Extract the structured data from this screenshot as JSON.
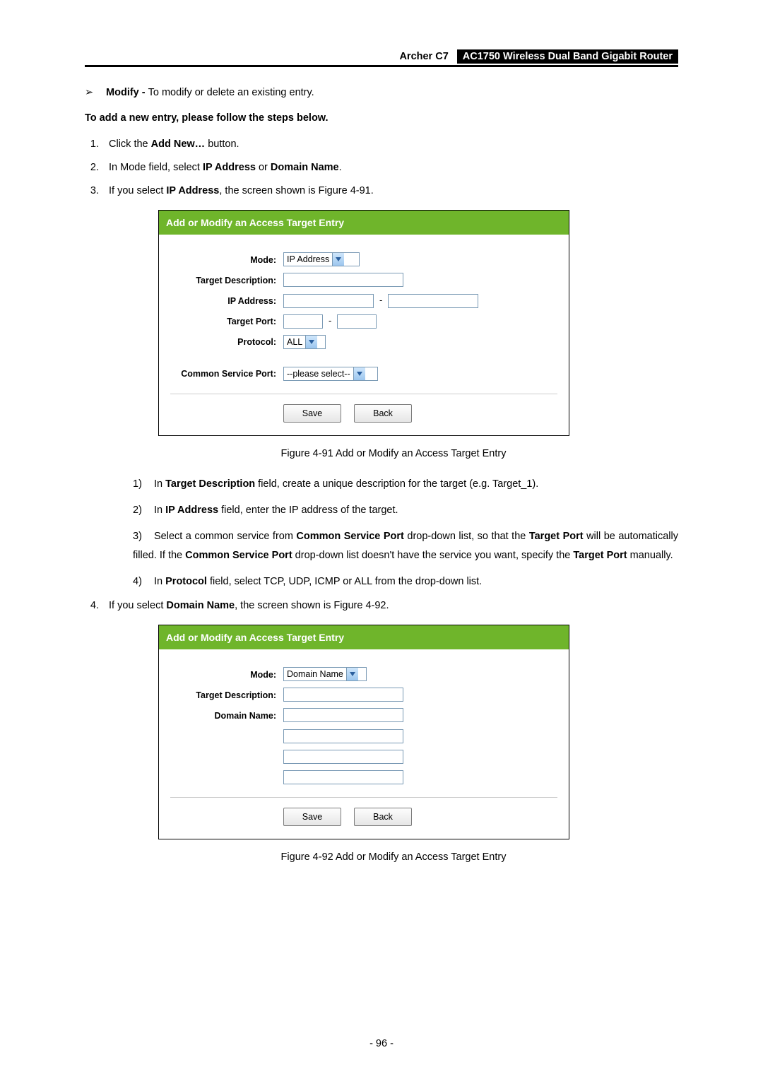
{
  "header": {
    "model": "Archer C7",
    "title": "AC1750 Wireless Dual Band Gigabit Router"
  },
  "intro": {
    "modify_label": "Modify - ",
    "modify_text": "To modify or delete an existing entry."
  },
  "steps_heading": "To add a new entry, please follow the steps below.",
  "step1_pre": "Click the ",
  "step1_bold": "Add New…",
  "step1_post": " button.",
  "step2_pre": "In Mode field, select ",
  "step2_bold1": "IP Address",
  "step2_mid": " or ",
  "step2_bold2": "Domain Name",
  "step2_post": ".",
  "step3_pre": "If you select ",
  "step3_bold": "IP Address",
  "step3_post": ", the screen shown is Figure 4-91.",
  "figure91": {
    "bar": "Add or Modify an Access Target Entry",
    "labels": {
      "mode": "Mode:",
      "target_desc": "Target Description:",
      "ip": "IP Address:",
      "target_port": "Target Port:",
      "protocol": "Protocol:",
      "csp": "Common Service Port:"
    },
    "values": {
      "mode": "IP Address",
      "protocol": "ALL",
      "csp": "--please select--"
    },
    "buttons": {
      "save": "Save",
      "back": "Back"
    },
    "caption": "Figure 4-91 Add or Modify an Access Target Entry"
  },
  "sub": {
    "n1": "1)",
    "n2": "2)",
    "n3": "3)",
    "n4": "4)",
    "s1a": "In ",
    "s1b": "Target Description",
    "s1c": " field, create a unique description for the target (e.g. Target_1).",
    "s2a": "In ",
    "s2b": "IP Address",
    "s2c": " field, enter the IP address of the target.",
    "s3a": "Select a common service from ",
    "s3b": "Common Service Port",
    "s3c": " drop-down list, so that the ",
    "s3d": "Target Port",
    "s3e": " will be automatically filled. If the ",
    "s3f": "Common Service Port",
    "s3g": " drop-down list doesn't have the service you want, specify the ",
    "s3h": "Target Port",
    "s3i": " manually.",
    "s4a": "In ",
    "s4b": "Protocol",
    "s4c": " field, select TCP, UDP, ICMP or ALL from the drop-down list."
  },
  "step4_pre": "If you select ",
  "step4_bold": "Domain Name",
  "step4_post": ", the screen shown is Figure 4-92.",
  "figure92": {
    "bar": "Add or Modify an Access Target Entry",
    "labels": {
      "mode": "Mode:",
      "target_desc": "Target Description:",
      "domain": "Domain Name:"
    },
    "values": {
      "mode": "Domain Name"
    },
    "buttons": {
      "save": "Save",
      "back": "Back"
    },
    "caption": "Figure 4-92 Add or Modify an Access Target Entry"
  },
  "page_number": "- 96 -"
}
